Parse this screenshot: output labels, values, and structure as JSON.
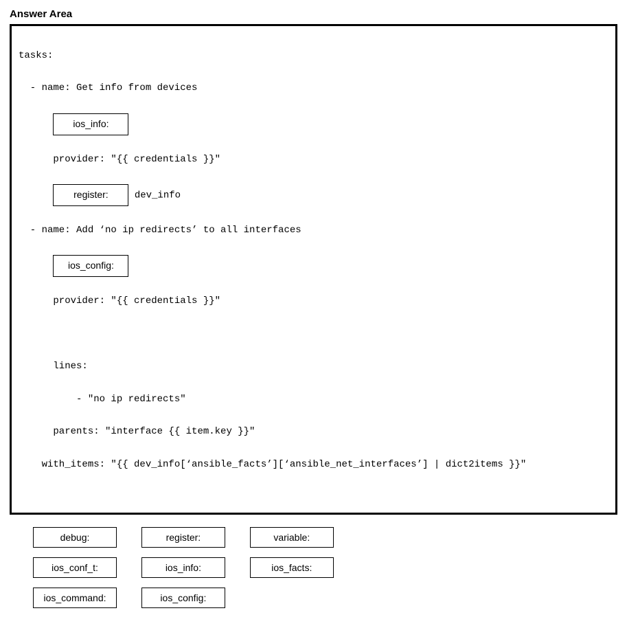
{
  "heading": "Answer Area",
  "code": {
    "l1": "tasks:",
    "l2": "  - name: Get info from devices",
    "slot1": "ios_info:",
    "l4": "      provider: \"{{ credentials }}\"",
    "slot2": "register:",
    "l5b": " dev_info",
    "l6": "  - name: Add ‘no ip redirects’ to all interfaces",
    "slot3": "ios_config:",
    "l8": "      provider: \"{{ credentials }}\"",
    "l9": "      lines:",
    "l10": "          - \"no ip redirects\"",
    "l11": "      parents: \"interface {{ item.key }}\"",
    "l12": "    with_items: \"{{ dev_info[‘ansible_facts’][‘ansible_net_interfaces’] | dict2items }}\""
  },
  "options": {
    "r1": [
      "debug:",
      "register:",
      "variable:"
    ],
    "r2": [
      "ios_conf_t:",
      "ios_info:",
      "ios_facts:"
    ],
    "r3": [
      "ios_command:",
      "ios_config:"
    ]
  }
}
